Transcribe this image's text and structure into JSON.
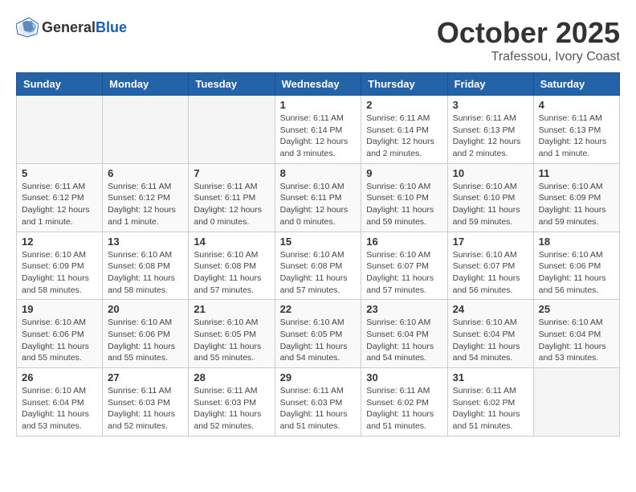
{
  "header": {
    "logo_general": "General",
    "logo_blue": "Blue",
    "month": "October 2025",
    "location": "Trafessou, Ivory Coast"
  },
  "days_of_week": [
    "Sunday",
    "Monday",
    "Tuesday",
    "Wednesday",
    "Thursday",
    "Friday",
    "Saturday"
  ],
  "weeks": [
    [
      {
        "day": "",
        "info": ""
      },
      {
        "day": "",
        "info": ""
      },
      {
        "day": "",
        "info": ""
      },
      {
        "day": "1",
        "info": "Sunrise: 6:11 AM\nSunset: 6:14 PM\nDaylight: 12 hours\nand 3 minutes."
      },
      {
        "day": "2",
        "info": "Sunrise: 6:11 AM\nSunset: 6:14 PM\nDaylight: 12 hours\nand 2 minutes."
      },
      {
        "day": "3",
        "info": "Sunrise: 6:11 AM\nSunset: 6:13 PM\nDaylight: 12 hours\nand 2 minutes."
      },
      {
        "day": "4",
        "info": "Sunrise: 6:11 AM\nSunset: 6:13 PM\nDaylight: 12 hours\nand 1 minute."
      }
    ],
    [
      {
        "day": "5",
        "info": "Sunrise: 6:11 AM\nSunset: 6:12 PM\nDaylight: 12 hours\nand 1 minute."
      },
      {
        "day": "6",
        "info": "Sunrise: 6:11 AM\nSunset: 6:12 PM\nDaylight: 12 hours\nand 1 minute."
      },
      {
        "day": "7",
        "info": "Sunrise: 6:11 AM\nSunset: 6:11 PM\nDaylight: 12 hours\nand 0 minutes."
      },
      {
        "day": "8",
        "info": "Sunrise: 6:10 AM\nSunset: 6:11 PM\nDaylight: 12 hours\nand 0 minutes."
      },
      {
        "day": "9",
        "info": "Sunrise: 6:10 AM\nSunset: 6:10 PM\nDaylight: 11 hours\nand 59 minutes."
      },
      {
        "day": "10",
        "info": "Sunrise: 6:10 AM\nSunset: 6:10 PM\nDaylight: 11 hours\nand 59 minutes."
      },
      {
        "day": "11",
        "info": "Sunrise: 6:10 AM\nSunset: 6:09 PM\nDaylight: 11 hours\nand 59 minutes."
      }
    ],
    [
      {
        "day": "12",
        "info": "Sunrise: 6:10 AM\nSunset: 6:09 PM\nDaylight: 11 hours\nand 58 minutes."
      },
      {
        "day": "13",
        "info": "Sunrise: 6:10 AM\nSunset: 6:08 PM\nDaylight: 11 hours\nand 58 minutes."
      },
      {
        "day": "14",
        "info": "Sunrise: 6:10 AM\nSunset: 6:08 PM\nDaylight: 11 hours\nand 57 minutes."
      },
      {
        "day": "15",
        "info": "Sunrise: 6:10 AM\nSunset: 6:08 PM\nDaylight: 11 hours\nand 57 minutes."
      },
      {
        "day": "16",
        "info": "Sunrise: 6:10 AM\nSunset: 6:07 PM\nDaylight: 11 hours\nand 57 minutes."
      },
      {
        "day": "17",
        "info": "Sunrise: 6:10 AM\nSunset: 6:07 PM\nDaylight: 11 hours\nand 56 minutes."
      },
      {
        "day": "18",
        "info": "Sunrise: 6:10 AM\nSunset: 6:06 PM\nDaylight: 11 hours\nand 56 minutes."
      }
    ],
    [
      {
        "day": "19",
        "info": "Sunrise: 6:10 AM\nSunset: 6:06 PM\nDaylight: 11 hours\nand 55 minutes."
      },
      {
        "day": "20",
        "info": "Sunrise: 6:10 AM\nSunset: 6:06 PM\nDaylight: 11 hours\nand 55 minutes."
      },
      {
        "day": "21",
        "info": "Sunrise: 6:10 AM\nSunset: 6:05 PM\nDaylight: 11 hours\nand 55 minutes."
      },
      {
        "day": "22",
        "info": "Sunrise: 6:10 AM\nSunset: 6:05 PM\nDaylight: 11 hours\nand 54 minutes."
      },
      {
        "day": "23",
        "info": "Sunrise: 6:10 AM\nSunset: 6:04 PM\nDaylight: 11 hours\nand 54 minutes."
      },
      {
        "day": "24",
        "info": "Sunrise: 6:10 AM\nSunset: 6:04 PM\nDaylight: 11 hours\nand 54 minutes."
      },
      {
        "day": "25",
        "info": "Sunrise: 6:10 AM\nSunset: 6:04 PM\nDaylight: 11 hours\nand 53 minutes."
      }
    ],
    [
      {
        "day": "26",
        "info": "Sunrise: 6:10 AM\nSunset: 6:04 PM\nDaylight: 11 hours\nand 53 minutes."
      },
      {
        "day": "27",
        "info": "Sunrise: 6:11 AM\nSunset: 6:03 PM\nDaylight: 11 hours\nand 52 minutes."
      },
      {
        "day": "28",
        "info": "Sunrise: 6:11 AM\nSunset: 6:03 PM\nDaylight: 11 hours\nand 52 minutes."
      },
      {
        "day": "29",
        "info": "Sunrise: 6:11 AM\nSunset: 6:03 PM\nDaylight: 11 hours\nand 51 minutes."
      },
      {
        "day": "30",
        "info": "Sunrise: 6:11 AM\nSunset: 6:02 PM\nDaylight: 11 hours\nand 51 minutes."
      },
      {
        "day": "31",
        "info": "Sunrise: 6:11 AM\nSunset: 6:02 PM\nDaylight: 11 hours\nand 51 minutes."
      },
      {
        "day": "",
        "info": ""
      }
    ]
  ]
}
